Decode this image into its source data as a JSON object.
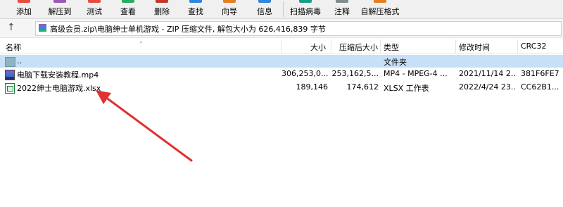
{
  "toolbar": {
    "buttons": [
      {
        "label": "添加",
        "color": "#e74c3c"
      },
      {
        "label": "解压到",
        "color": "#9b59b6"
      },
      {
        "label": "测试",
        "color": "#e74c3c"
      },
      {
        "label": "查看",
        "color": "#27ae60"
      },
      {
        "label": "删除",
        "color": "#c0392b"
      },
      {
        "label": "查找",
        "color": "#2e86de"
      },
      {
        "label": "向导",
        "color": "#e67e22"
      },
      {
        "label": "信息",
        "color": "#2e86de"
      },
      {
        "label": "扫描病毒",
        "color": "#16a085"
      },
      {
        "label": "注释",
        "color": "#7f8c8d"
      },
      {
        "label": "自解压格式",
        "color": "#e67e22"
      }
    ]
  },
  "address": {
    "path": "高级会员.zip\\电脑绅士单机游戏 - ZIP 压缩文件, 解包大小为 626,416,839 字节"
  },
  "columns": {
    "name": "名称",
    "size": "大小",
    "packed": "压缩后大小",
    "type": "类型",
    "modified": "修改时间",
    "crc": "CRC32"
  },
  "rows": [
    {
      "name": "..",
      "size": "",
      "packed": "",
      "type": "文件夹",
      "modified": "",
      "crc": ""
    },
    {
      "name": "电脑下载安装教程.mp4",
      "size": "306,253,0...",
      "packed": "253,162,5...",
      "type": "MP4 - MPEG-4 ...",
      "modified": "2021/11/14 2...",
      "crc": "381F6FE7"
    },
    {
      "name": "2022绅士电脑游戏.xlsx",
      "size": "189,146",
      "packed": "174,612",
      "type": "XLSX 工作表",
      "modified": "2022/4/24 23...",
      "crc": "CC62B1..."
    }
  ],
  "annotation": {
    "arrow_color": "#e03131"
  }
}
